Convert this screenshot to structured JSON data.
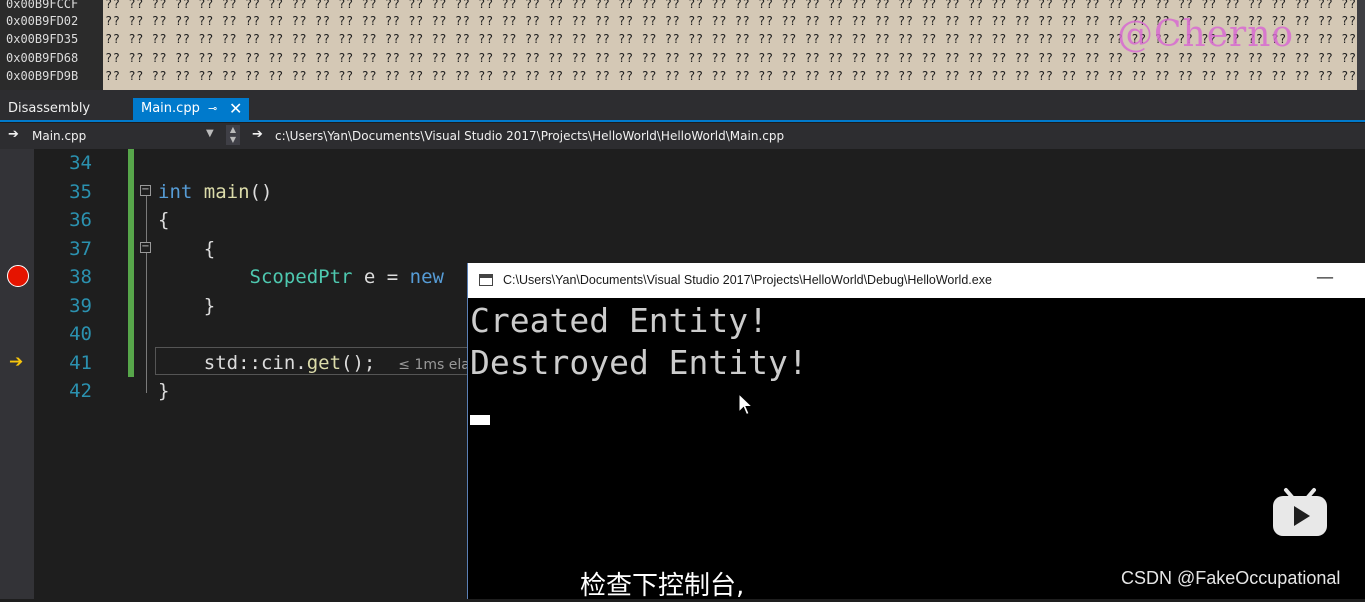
{
  "memory": {
    "rows": [
      {
        "address": "0x00B9FCCF",
        "bytes": "?? ?? ?? ?? ?? ?? ?? ?? ?? ?? ?? ?? ?? ?? ?? ?? ?? ?? ?? ?? ?? ?? ?? ?? ?? ?? ?? ?? ?? ?? ?? ?? ?? ?? ?? ?? ?? ?? ?? ?? ?? ?? ?? ?? ?? ?? ?? ?? ?? ?? ?? ?? ?? ?? ?? ?? ?? ?? ?? ?? ?? ?? ?? ?? ?? ?? ?? ?? ?? ?? ?? ?? ?? ?? ?? ?? ?? ?? ?? ?? ?? ?? ?? ?? ?? ?? ?? ?? ?? ?? ??"
      },
      {
        "address": "0x00B9FD02",
        "bytes": "?? ?? ?? ?? ?? ?? ?? ?? ?? ?? ?? ?? ?? ?? ?? ?? ?? ?? ?? ?? ?? ?? ?? ?? ?? ?? ?? ?? ?? ?? ?? ?? ?? ?? ?? ?? ?? ?? ?? ?? ?? ?? ?? ?? ?? ?? ?? ?? ?? ?? ?? ?? ?? ?? ?? ?? ?? ?? ?? ?? ?? ?? ?? ?? ?? ?? ?? ?? ?? ?? ?? ?? ?? ?? ?? ?? ?? ?? ?? ?? ?? ?? ?? ?? ?? ?? ?? ?? ?? ?? ??"
      },
      {
        "address": "0x00B9FD35",
        "bytes": "?? ?? ?? ?? ?? ?? ?? ?? ?? ?? ?? ?? ?? ?? ?? ?? ?? ?? ?? ?? ?? ?? ?? ?? ?? ?? ?? ?? ?? ?? ?? ?? ?? ?? ?? ?? ?? ?? ?? ?? ?? ?? ?? ?? ?? ?? ?? ?? ?? ?? ?? ?? ?? ?? ?? ?? ?? ?? ?? ?? ?? ?? ?? ?? ?? ?? ?? ?? ?? ?? ?? ?? ?? ?? ?? ?? ?? ?? ?? ?? ?? ?? ?? ?? ?? ?? ?? ?? ?? ?? ??"
      },
      {
        "address": "0x00B9FD68",
        "bytes": "?? ?? ?? ?? ?? ?? ?? ?? ?? ?? ?? ?? ?? ?? ?? ?? ?? ?? ?? ?? ?? ?? ?? ?? ?? ?? ?? ?? ?? ?? ?? ?? ?? ?? ?? ?? ?? ?? ?? ?? ?? ?? ?? ?? ?? ?? ?? ?? ?? ?? ?? ?? ?? ?? ?? ?? ?? ?? ?? ?? ?? ?? ?? ?? ?? ?? ?? ?? ?? ?? ?? ?? ?? ?? ?? ?? ?? ?? ?? ?? ?? ?? ?? ?? ?? ?? ?? ?? ?? ?? ??"
      },
      {
        "address": "0x00B9FD9B",
        "bytes": "?? ?? ?? ?? ?? ?? ?? ?? ?? ?? ?? ?? ?? ?? ?? ?? ?? ?? ?? ?? ?? ?? ?? ?? ?? ?? ?? ?? ?? ?? ?? ?? ?? ?? ?? ?? ?? ?? ?? ?? ?? ?? ?? ?? ?? ?? ?? ?? ?? ?? ?? ?? ?? ?? ?? ?? ?? ?? ?? ?? ?? ?? ?? ?? ?? ?? ?? ?? ?? ?? ?? ?? ?? ?? ?? ?? ?? ?? ?? ?? ?? ?? ?? ?? ?? ?? ?? ?? ?? ?? ??"
      }
    ],
    "watermark": "@Cherno"
  },
  "tabs": {
    "disassembly": "Disassembly",
    "main": "Main.cpp",
    "pin_glyph": "⊸",
    "close_glyph": "✕"
  },
  "navbar": {
    "file": "Main.cpp",
    "path": "c:\\Users\\Yan\\Documents\\Visual Studio 2017\\Projects\\HelloWorld\\HelloWorld\\Main.cpp"
  },
  "editor": {
    "lines": [
      {
        "number": "34"
      },
      {
        "number": "35",
        "kw": "int",
        "fn": "main",
        "rest": "()"
      },
      {
        "number": "36",
        "rest": "{"
      },
      {
        "number": "37",
        "rest": "    {"
      },
      {
        "number": "38",
        "ty": "ScopedPtr",
        "rest": " e = ",
        "kw": "new"
      },
      {
        "number": "39",
        "rest": "    }"
      },
      {
        "number": "40"
      },
      {
        "number": "41",
        "pre": "    std::cin.",
        "fn": "get",
        "rest": "();",
        "hint": "≤ 1ms ela"
      },
      {
        "number": "42",
        "rest": "}"
      }
    ]
  },
  "console": {
    "title": "C:\\Users\\Yan\\Documents\\Visual Studio 2017\\Projects\\HelloWorld\\Debug\\HelloWorld.exe",
    "minimize_glyph": "—",
    "output": [
      "Created Entity!",
      "Destroyed Entity!"
    ]
  },
  "overlay": {
    "subtitle": "检查下控制台,",
    "csdn": "CSDN @FakeOccupational"
  },
  "colors": {
    "accent": "#007acc",
    "breakpoint": "#e51400",
    "keyword": "#569cd6",
    "type": "#4ec9b0",
    "function": "#dcdcaa",
    "line_number": "#2b91af"
  }
}
